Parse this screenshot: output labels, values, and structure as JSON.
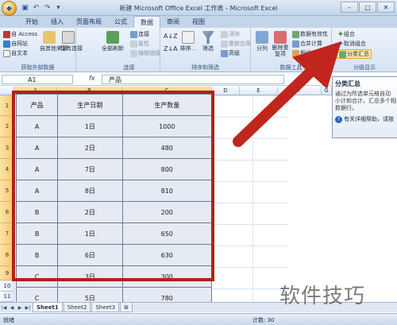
{
  "window": {
    "title": "新建 Microsoft Office Excel 工作表 - Microsoft Excel"
  },
  "tabs": [
    "开始",
    "插入",
    "页面布局",
    "公式",
    "数据",
    "审阅",
    "视图"
  ],
  "ribbon": {
    "external": {
      "access": "自 Access",
      "web": "自网站",
      "text": "自文本",
      "other": "自其他来源",
      "existing": "现有连接",
      "label": "获取外部数据"
    },
    "connections": {
      "refresh": "全部刷新",
      "connect": "连接",
      "props": "属性",
      "edit": "编辑链接",
      "label": "连接"
    },
    "sort": {
      "sort": "排序...",
      "filter": "筛选",
      "clear": "清除",
      "reapply": "重新应用",
      "advanced": "高级",
      "label": "排序和筛选"
    },
    "tools": {
      "split": "分列",
      "dedupe": "删除重复项",
      "validation": "数据有效性",
      "consolidate": "合并计算",
      "whatif": "假设分析",
      "label": "数据工具"
    },
    "outline": {
      "group": "组合",
      "ungroup": "取消组合",
      "subtotal": "分类汇总",
      "label": "分级显示"
    }
  },
  "formula_bar": {
    "cell_ref": "A1",
    "fx": "fx",
    "content": "产品"
  },
  "columns": [
    "A",
    "B",
    "C",
    "D",
    "E",
    "F",
    "G"
  ],
  "rows": [
    "1",
    "2",
    "3",
    "4",
    "5",
    "6",
    "7",
    "8",
    "9",
    "10",
    "11"
  ],
  "table": {
    "headers": [
      "产品",
      "生产日期",
      "生产数量"
    ],
    "rows": [
      [
        "A",
        "1日",
        "1000"
      ],
      [
        "A",
        "2日",
        "480"
      ],
      [
        "A",
        "7日",
        "800"
      ],
      [
        "A",
        "8日",
        "810"
      ],
      [
        "B",
        "2日",
        "200"
      ],
      [
        "B",
        "1日",
        "650"
      ],
      [
        "B",
        "6日",
        "630"
      ],
      [
        "C",
        "3日",
        "300"
      ],
      [
        "C",
        "5日",
        "780"
      ]
    ]
  },
  "tooltip": {
    "title": "分类汇总",
    "line1": "通过为所选单元格自动",
    "line2": "小计和合计，汇总多个相",
    "line3": "数据行。",
    "help": "有关详细帮助，请按"
  },
  "sheets": [
    "Sheet1",
    "Sheet2",
    "Sheet3"
  ],
  "status": {
    "ready": "就绪",
    "count": "计数: 30"
  },
  "watermark": "软件技巧",
  "colors": {
    "frame": "#b0211b",
    "arrow": "#c0261d",
    "selection": "#f7c46a"
  }
}
